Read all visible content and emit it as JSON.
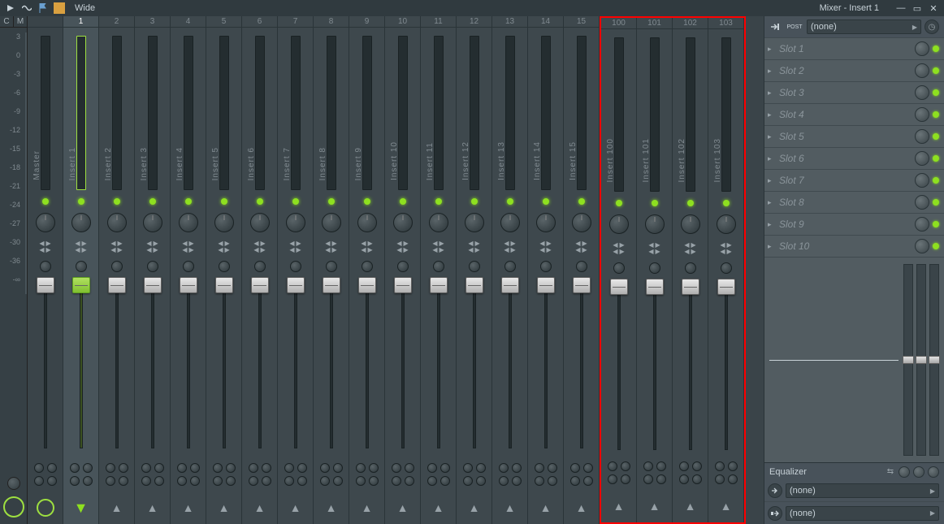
{
  "titlebar": {
    "layout_label": "Wide",
    "window_title": "Mixer - Insert 1"
  },
  "dbscale": {
    "header_left": "C",
    "header_right": "M",
    "ticks": [
      "3",
      "0",
      "-3",
      "-6",
      "-9",
      "-12",
      "-15",
      "-18",
      "-21",
      "-24",
      "-27",
      "-30",
      "-36",
      "-∞"
    ]
  },
  "tracks_left": [
    {
      "num": "",
      "label": "Master",
      "master": true
    },
    {
      "num": "1",
      "label": "Insert 1",
      "selected": true
    },
    {
      "num": "2",
      "label": "Insert 2"
    },
    {
      "num": "3",
      "label": "Insert 3"
    },
    {
      "num": "4",
      "label": "Insert 4"
    },
    {
      "num": "5",
      "label": "Insert 5"
    },
    {
      "num": "6",
      "label": "Insert 6"
    },
    {
      "num": "7",
      "label": "Insert 7"
    },
    {
      "num": "8",
      "label": "Insert 8"
    },
    {
      "num": "9",
      "label": "Insert 9"
    },
    {
      "num": "10",
      "label": "Insert 10"
    },
    {
      "num": "11",
      "label": "Insert 11"
    },
    {
      "num": "12",
      "label": "Insert 12"
    },
    {
      "num": "13",
      "label": "Insert 13"
    },
    {
      "num": "14",
      "label": "Insert 14"
    },
    {
      "num": "15",
      "label": "Insert 15"
    }
  ],
  "tracks_right": [
    {
      "num": "100",
      "label": "Insert 100"
    },
    {
      "num": "101",
      "label": "Insert 101"
    },
    {
      "num": "102",
      "label": "Insert 102"
    },
    {
      "num": "103",
      "label": "Insert 103"
    }
  ],
  "rightpanel": {
    "input_routing": "(none)",
    "post_label": "POST",
    "slots": [
      "Slot 1",
      "Slot 2",
      "Slot 3",
      "Slot 4",
      "Slot 5",
      "Slot 6",
      "Slot 7",
      "Slot 8",
      "Slot 9",
      "Slot 10"
    ],
    "equalizer_label": "Equalizer",
    "output_routing_1": "(none)",
    "output_routing_2": "(none)"
  }
}
